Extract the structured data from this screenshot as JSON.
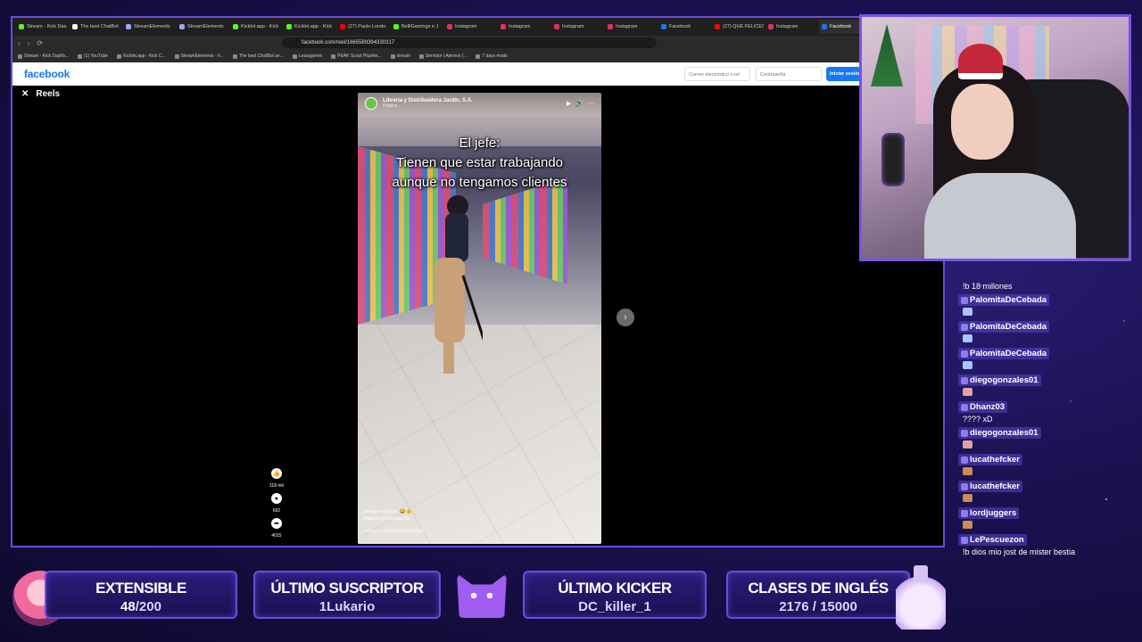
{
  "browser": {
    "tabs": [
      {
        "label": "Stream - Kick Das",
        "color": "#53fc18",
        "active": false
      },
      {
        "label": "The best ChatBot",
        "color": "#ffffff",
        "active": false
      },
      {
        "label": "StreamElements",
        "color": "#9aa5ff",
        "active": false
      },
      {
        "label": "StreamElements",
        "color": "#9aa5ff",
        "active": false
      },
      {
        "label": "Kicklet.app - Kick",
        "color": "#53fc18",
        "active": false
      },
      {
        "label": "Kicklet.app - Kick",
        "color": "#53fc18",
        "active": false
      },
      {
        "label": "(27) Paulo Londo",
        "color": "#ff0000",
        "active": false
      },
      {
        "label": "BelliGamings e J",
        "color": "#53fc18",
        "active": false
      },
      {
        "label": "Instagram",
        "color": "#e1306c",
        "active": false
      },
      {
        "label": "Instagram",
        "color": "#e1306c",
        "active": false
      },
      {
        "label": "Instagram",
        "color": "#e1306c",
        "active": false
      },
      {
        "label": "Instagram",
        "color": "#e1306c",
        "active": false
      },
      {
        "label": "Facebook",
        "color": "#1877f2",
        "active": false
      },
      {
        "label": "(27) QUE FELICES",
        "color": "#ff0000",
        "active": false
      },
      {
        "label": "Instagram",
        "color": "#e1306c",
        "active": false
      },
      {
        "label": "Facebook",
        "color": "#1877f2",
        "active": true
      }
    ],
    "url": "facebook.com/reel/1665589394330317",
    "bookmarks": [
      "Stream - Kick Dashb...",
      "(1) YouTube",
      "Kicklet.app - Kick C...",
      "StreamElements - h...",
      "The best ChatBot an...",
      "Leaogames",
      "PEAK Scout Plushie...",
      "stream",
      "Servidor | Aternos |...",
      "7 days mods"
    ]
  },
  "facebook": {
    "logo": "facebook",
    "email_placeholder": "Correo electrónico o tel",
    "password_placeholder": "Contraseña",
    "login_button": "Iniciar sesión",
    "reels_label": "Reels",
    "close_symbol": "✕"
  },
  "reel": {
    "page_name": "Librería y Distribuidora Jardín, S.A.",
    "visibility": "Público",
    "caption_lines": [
      "El jefe:",
      "Tienen que estar trabajando",
      "aunque no tengamos clientes"
    ],
    "description": "Siempre activos 😂👍",
    "hashtags": "#humor #comedia #fy",
    "author_footer": "Librería y Distribuidora Jard",
    "likes": "118 mil",
    "comments": "692",
    "shares": "4015",
    "next_symbol": "›"
  },
  "chat": [
    {
      "user": "",
      "text": "!b 18 millones",
      "emote": ""
    },
    {
      "user": "PalomitaDeCebada",
      "text": "",
      "emote": "e1"
    },
    {
      "user": "PalomitaDeCebada",
      "text": "",
      "emote": "e1"
    },
    {
      "user": "PalomitaDeCebada",
      "text": "",
      "emote": "e1"
    },
    {
      "user": "diegogonzales01",
      "text": "",
      "emote": "e2"
    },
    {
      "user": "Dhanz03",
      "text": "???? xD",
      "emote": ""
    },
    {
      "user": "diegogonzales01",
      "text": "",
      "emote": "e2"
    },
    {
      "user": "lucathefcker",
      "text": "",
      "emote": "e3"
    },
    {
      "user": "lucathefcker",
      "text": "",
      "emote": "e3"
    },
    {
      "user": "lordjuggers",
      "text": "",
      "emote": "e3"
    },
    {
      "user": "LePescuezon",
      "text": "!b dios mio jost de mister bestia",
      "emote": ""
    }
  ],
  "overlay": {
    "extensible": {
      "title": "EXTENSIBLE",
      "current": "48",
      "total": "/200"
    },
    "ultimo_suscriptor": {
      "title": "ÚLTIMO SUSCRIPTOR",
      "value": "1Lukario"
    },
    "ultimo_kicker": {
      "title": "ÚLTIMO KICKER",
      "value": "DC_killer_1"
    },
    "clases": {
      "title": "CLASES DE INGLÉS",
      "value": "2176 / 15000"
    }
  },
  "colors": {
    "accent": "#7a52e6",
    "fb_blue": "#1877f2",
    "bg": "#1a1150"
  }
}
